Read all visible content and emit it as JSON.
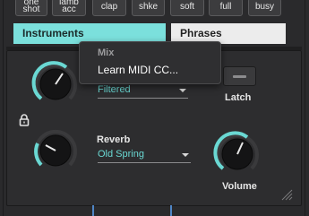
{
  "pads": [
    {
      "lines": [
        "one",
        "shot"
      ]
    },
    {
      "lines": [
        "lamb",
        "acc"
      ]
    },
    {
      "lines": [
        "clap"
      ]
    },
    {
      "lines": [
        "shke"
      ]
    },
    {
      "lines": [
        "soft"
      ]
    },
    {
      "lines": [
        "full"
      ]
    },
    {
      "lines": [
        "busy"
      ]
    }
  ],
  "tabs": {
    "instruments": "Instruments",
    "phrases": "Phrases"
  },
  "context_menu": {
    "header": "Mix",
    "item": "Learn MIDI CC..."
  },
  "top_dropdown": {
    "value": "Filtered"
  },
  "latch": {
    "label": "Latch"
  },
  "reverb": {
    "label": "Reverb",
    "value": "Old Spring"
  },
  "volume": {
    "label": "Volume"
  },
  "colors": {
    "accent": "#6ad8d3",
    "tab_active": "#7be0dc",
    "tab_inactive": "#ececec",
    "marker": "#4f86c6"
  },
  "icons": [
    "lock-icon",
    "resize-grip-icon",
    "chevron-down-icon"
  ]
}
